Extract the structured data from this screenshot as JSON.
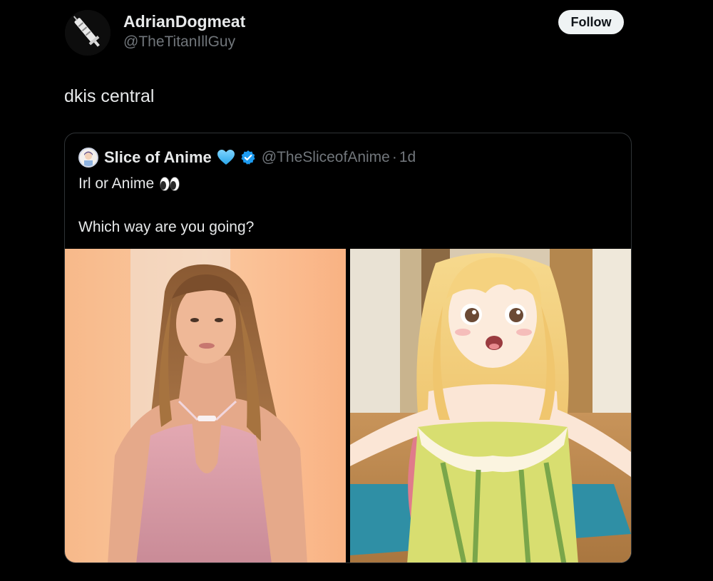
{
  "author": {
    "display_name": "AdrianDogmeat",
    "handle": "@TheTitanIllGuy",
    "avatar_icon": "syringe-icon"
  },
  "follow_button": {
    "label": "Follow"
  },
  "tweet": {
    "text": "dkis central"
  },
  "quoted_tweet": {
    "display_name": "Slice of Anime",
    "badges": [
      "blue-heart-icon",
      "verified-badge-icon"
    ],
    "handle": "@TheSliceofAnime",
    "separator": "·",
    "time": "1d",
    "line1": "Irl or Anime",
    "line1_emoji": "eyes-icon",
    "line2": "Which way are you going?",
    "media": [
      {
        "kind": "photo",
        "description_icon": "photo-woman-pink-dress"
      },
      {
        "kind": "image",
        "description_icon": "anime-girl-illustration"
      }
    ]
  },
  "colors": {
    "background": "#000000",
    "primary_text": "#e7e9ea",
    "secondary_text": "#71767b",
    "border": "#2f3336",
    "follow_bg": "#eff3f4",
    "verified_blue": "#1d9bf0"
  }
}
